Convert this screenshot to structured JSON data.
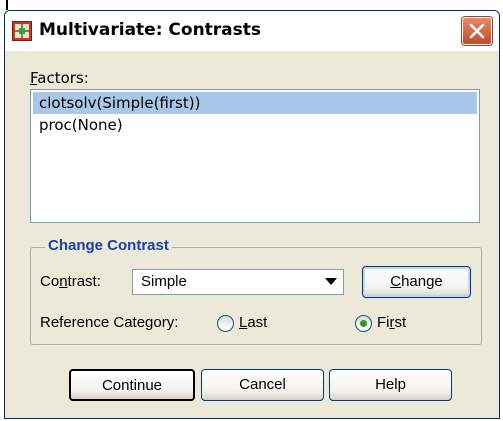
{
  "dialog": {
    "title": "Multivariate: Contrasts"
  },
  "factors": {
    "label_prefix": "",
    "label_mnemonic": "F",
    "label_rest": "actors:",
    "items": [
      {
        "label": "clotsolv(Simple(first))",
        "selected": true
      },
      {
        "label": "proc(None)",
        "selected": false
      }
    ]
  },
  "change_contrast": {
    "group_title": "Change Contrast",
    "contrast_label_a": "Co",
    "contrast_label_mn": "n",
    "contrast_label_b": "trast:",
    "contrast_value": "Simple",
    "change_button_a": "",
    "change_button_mn": "C",
    "change_button_b": "hange",
    "reference_label": "Reference Category:",
    "last_mn": "L",
    "last_rest": "ast",
    "first_a": "Fi",
    "first_mn": "r",
    "first_b": "st",
    "selected_reference": "First"
  },
  "buttons": {
    "continue": "Continue",
    "cancel": "Cancel",
    "help": "Help"
  },
  "icons": {
    "app": "spss-dialog-icon",
    "close": "close-icon"
  },
  "colors": {
    "group_title": "#1c3fa8",
    "selection": "#a9c7e8",
    "radio_dot": "#2c9a2c",
    "close_button": "#c14a2e"
  }
}
